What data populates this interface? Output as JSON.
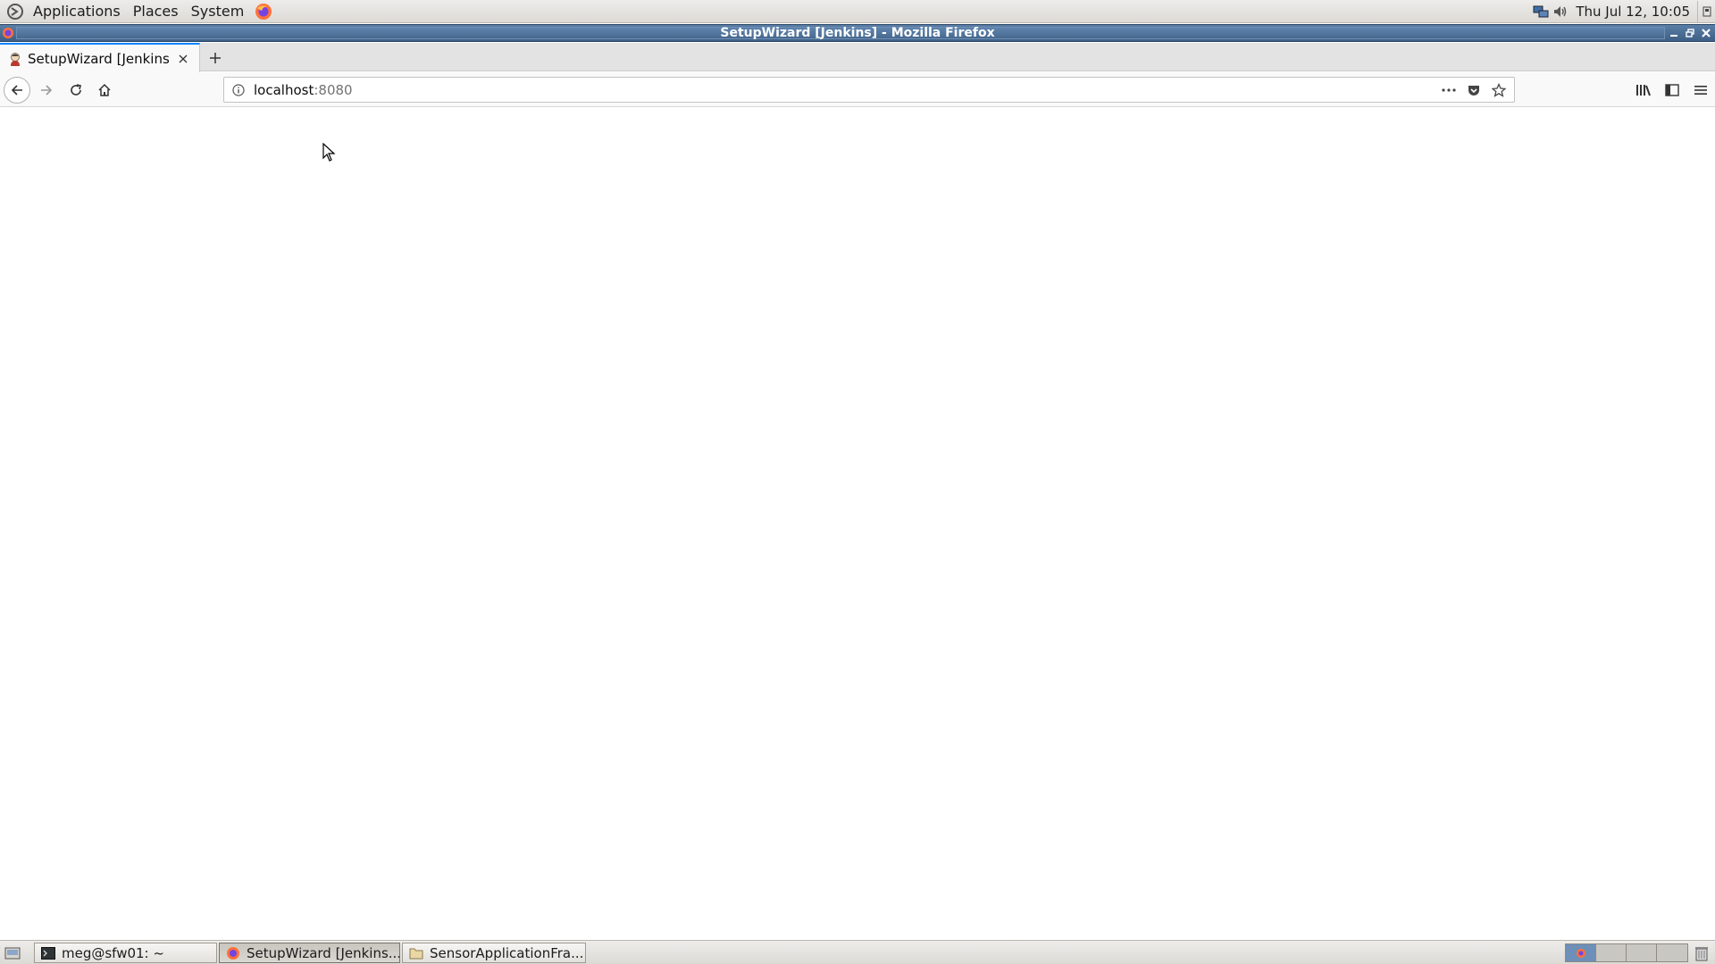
{
  "top_panel": {
    "menus": [
      "Applications",
      "Places",
      "System"
    ],
    "clock": "Thu Jul 12, 10:05"
  },
  "window": {
    "title": "SetupWizard [Jenkins] - Mozilla Firefox"
  },
  "browser": {
    "tab": {
      "title": "SetupWizard [Jenkins]"
    },
    "url": {
      "host": "localhost",
      "port": ":8080"
    }
  },
  "taskbar": {
    "tasks": [
      {
        "label": "meg@sfw01: ~",
        "icon": "terminal-icon",
        "active": false
      },
      {
        "label": "SetupWizard [Jenkins...",
        "icon": "firefox-icon",
        "active": true
      },
      {
        "label": "SensorApplicationFra...",
        "icon": "folder-icon",
        "active": false
      }
    ]
  },
  "colors": {
    "titlebar": "#4a6b92",
    "tab_accent": "#0a84ff",
    "workspace_active": "#6d8fb8"
  }
}
